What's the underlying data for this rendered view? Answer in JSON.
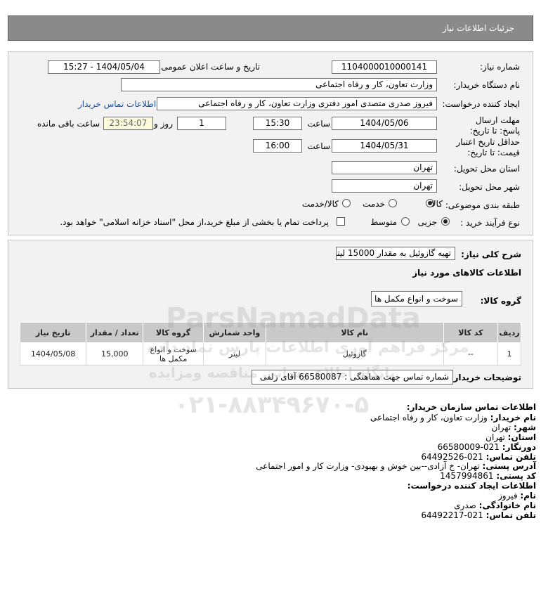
{
  "header": {
    "title": "جزئیات اطلاعات نیاز"
  },
  "details": {
    "need_number_label": "شماره نیاز:",
    "need_number": "1104000010000141",
    "announce_label": "تاریخ و ساعت اعلان عمومی:",
    "announce_value": "1404/05/04 - 15:27",
    "buyer_org_label": "نام دستگاه خریدار:",
    "buyer_org": "وزارت تعاون، کار و رفاه اجتماعی",
    "creator_label": "ایجاد کننده درخواست:",
    "creator": "فیروز صدری متصدی امور دفتری وزارت تعاون، کار و رفاه اجتماعی",
    "contact_link": "اطلاعات تماس خریدار",
    "deadline_label": "مهلت ارسال پاسخ: تا تاریخ:",
    "deadline_date": "1404/05/06",
    "time_label": "ساعت",
    "deadline_time": "15:30",
    "days_value": "1",
    "days_label": "روز و",
    "remaining_time": "23:54:07",
    "remaining_label": "ساعت باقی مانده",
    "validity_label": "حداقل تاریخ اعتبار قیمت: تا تاریخ:",
    "validity_date": "1404/05/31",
    "validity_time": "16:00",
    "province_label": "استان محل تحویل:",
    "province": "تهران",
    "city_label": "شهر محل تحویل:",
    "city": "تهران",
    "category_label": "طبقه بندی موضوعی:",
    "category_options": [
      "کالا",
      "خدمت",
      "کالا/خدمت"
    ],
    "category_selected": "کالا",
    "process_label": "نوع فرآیند خرید :",
    "process_options": [
      "جزیی",
      "متوسط"
    ],
    "process_selected": "جزیی",
    "payment_note": "پرداخت تمام یا بخشی از مبلغ خرید،از محل \"اسناد خزانه اسلامی\" خواهد بود."
  },
  "description": {
    "label": "شرح کلی نیاز:",
    "value": "تهیه گازوئیل به مقدار 15000 لیتر",
    "goods_info_title": "اطلاعات کالاهای مورد نیاز",
    "group_label": "گروه کالا:",
    "group_value": "سوخت و انواع مکمل ها"
  },
  "table": {
    "headers": [
      "ردیف",
      "کد کالا",
      "نام کالا",
      "واحد شمارش",
      "گروه کالا",
      "تعداد / مقدار",
      "تاریخ نیاز"
    ],
    "rows": [
      [
        "1",
        "--",
        "گازوئیل",
        "لیتر",
        "سوخت و انواع مکمل ها",
        "15,000",
        "1404/05/08"
      ]
    ]
  },
  "buyer_notes": {
    "label": "توضیحات خریدار:",
    "value": "شماره تماس جهت هماهنگی : 66580087 آقای زلفی"
  },
  "contact": {
    "title": "اطلاعات تماس سازمان خریدار:",
    "org_label": "نام خریدار:",
    "org": "وزارت تعاون، کار و رفاه اجتماعی",
    "city_label": "شهر:",
    "city": "تهران",
    "province_label": "استان:",
    "province": "تهران",
    "fax_label": "دورنگار:",
    "fax": "021-66580009",
    "phone_label": "تلفن تماس:",
    "phone": "021-64492526",
    "address_label": "آدرس پستی:",
    "address": "تهران- خ آزادی--بین خوش و بهبودی- وزارت کار و امور اجتماعی",
    "postal_label": "کد پستی:",
    "postal": "1457994861",
    "creator_title": "اطلاعات ایجاد کننده درخواست:",
    "name_label": "نام:",
    "name": "فیروز",
    "family_label": "نام خانوادگی:",
    "family": "صدری",
    "creator_phone_label": "تلفن تماس:",
    "creator_phone": "021-64492217"
  },
  "watermark": {
    "line1": "ParsNamadData",
    "line2": "مرکز فراهم آوری اطلاعات پارس نماد داده",
    "line3": "پایگاه اطلاع رسانی مناقصه ومزایده",
    "line4": "۰۲۱-۸۸۳۴۹۶۷۰-۵"
  }
}
